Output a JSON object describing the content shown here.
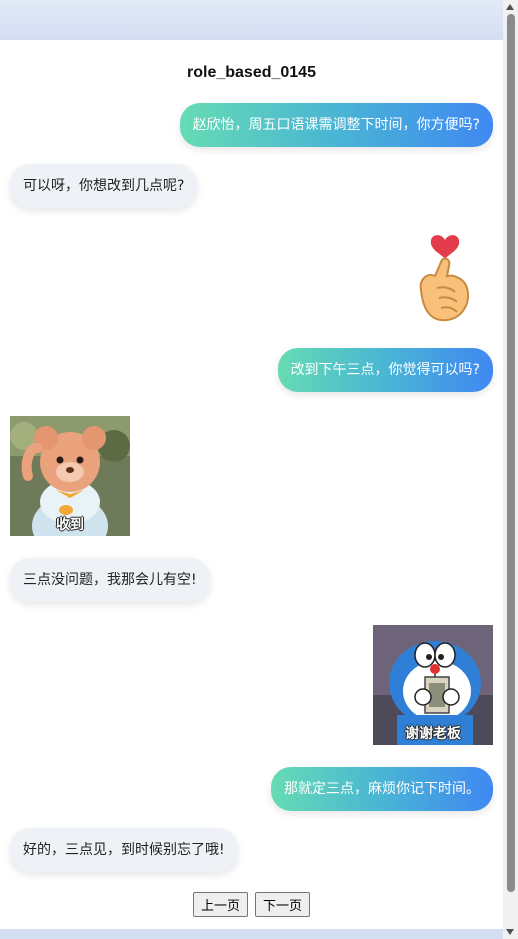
{
  "chat": {
    "title": "role_based_0145",
    "messages": [
      {
        "side": "right",
        "type": "text",
        "text": "赵欣怡，周五口语课需调整下时间，你方便吗?"
      },
      {
        "side": "left",
        "type": "text",
        "text": "可以呀，你想改到几点呢?"
      },
      {
        "side": "right",
        "type": "sticker",
        "icon": "finger-heart-icon"
      },
      {
        "side": "right",
        "type": "text",
        "text": "改到下午三点，你觉得可以吗?"
      },
      {
        "side": "left",
        "type": "sticker",
        "icon": "bear-mascot-sticker",
        "caption": "收到"
      },
      {
        "side": "left",
        "type": "text",
        "text": "三点没问题，我那会儿有空!"
      },
      {
        "side": "right",
        "type": "sticker",
        "icon": "doraemon-sticker",
        "caption": "谢谢老板"
      },
      {
        "side": "right",
        "type": "text",
        "text": "那就定三点，麻烦你记下时间。"
      },
      {
        "side": "left",
        "type": "text",
        "text": "好的，三点见，到时候别忘了哦!"
      }
    ]
  },
  "pager": {
    "prev_label": "上一页",
    "next_label": "下一页"
  },
  "colors": {
    "bubble_gradient_start": "#66dbb4",
    "bubble_gradient_end": "#3f88f2",
    "left_bubble": "#eef2f7"
  }
}
